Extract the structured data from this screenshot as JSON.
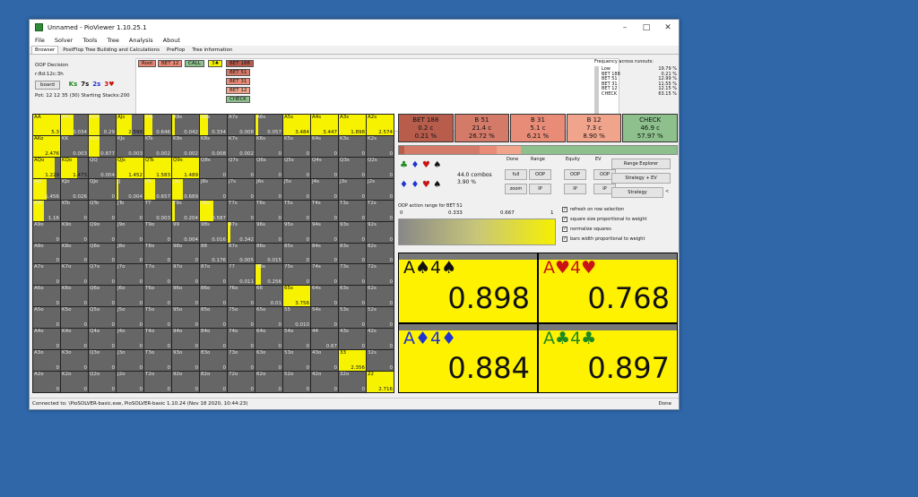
{
  "window": {
    "title": "Unnamed - PioViewer 1.10.25.1",
    "menus": [
      "File",
      "Solver",
      "Tools",
      "Tree",
      "Analysis",
      "About"
    ],
    "tabs": [
      "Browser",
      "PostFlop Tree Building and Calculations",
      "PreFlop",
      "Tree information"
    ]
  },
  "info": {
    "player": "OOP Decision",
    "board_cards": "r:8d:12c:3h",
    "board_button": "board",
    "cards": [
      {
        "t": "Ks",
        "c": "#1e8a1e"
      },
      {
        "t": "7s",
        "c": "#111"
      },
      {
        "t": "2s",
        "c": "#1e33d1"
      },
      {
        "t": "3♥",
        "c": "#c81414"
      }
    ],
    "pot_line": "Pot: 12 12 35 (30) Starting Stacks:200"
  },
  "tree": {
    "nodes": [
      {
        "label": "Root",
        "bg": "#e88874"
      },
      {
        "label": "BET 12",
        "bg": "#e88874"
      },
      {
        "label": "CALL",
        "bg": "#8dc08d"
      },
      {
        "label": "3♠",
        "bg": "#f6f200"
      },
      {
        "label": "BET 188",
        "bg": "#b85c4c"
      },
      {
        "label": "BET 51",
        "bg": "#d47a68"
      },
      {
        "label": "BET 31",
        "bg": "#e88c78"
      },
      {
        "label": "BET 12",
        "bg": "#f0a48c"
      },
      {
        "label": "CHECK",
        "bg": "#8dc08d"
      }
    ]
  },
  "frequency": {
    "header": "Frequency across runouts:",
    "rows": [
      {
        "name": "Low",
        "value": "19.79 %"
      },
      {
        "name": "",
        "value": ""
      },
      {
        "name": "BET 188",
        "value": "0.21 %"
      },
      {
        "name": "BET 51",
        "value": "12.99 %"
      },
      {
        "name": "BET 31",
        "value": "11.55 %"
      },
      {
        "name": "BET 12",
        "value": "12.15 %"
      },
      {
        "name": "CHECK",
        "value": "63.15 %"
      }
    ]
  },
  "matrix": {
    "cells": [
      [
        "AA",
        "5.3",
        1
      ],
      [
        "AKs",
        "0.034",
        0.45
      ],
      [
        "AQs",
        "0.29",
        0.4
      ],
      [
        "AJs",
        "2.599",
        0.55
      ],
      [
        "ATs",
        "0.646",
        0.3
      ],
      [
        "A9s",
        "0.042",
        0.1
      ],
      [
        "A8s",
        "0.334",
        0.3
      ],
      [
        "A7s",
        "0.008",
        0
      ],
      [
        "A6s",
        "0.057",
        0.1
      ],
      [
        "A5s",
        "3.484",
        1
      ],
      [
        "A4s",
        "3.447",
        1
      ],
      [
        "A3s",
        "1.898",
        1
      ],
      [
        "A2s",
        "2.574",
        1
      ],
      [
        "AKo",
        "2.476",
        1
      ],
      [
        "KK",
        "0.003",
        0
      ],
      [
        "KQs",
        "0.877",
        0.4
      ],
      [
        "KJs",
        "0.003",
        0
      ],
      [
        "KTs",
        "0.002",
        0
      ],
      [
        "K9s",
        "0.002",
        0
      ],
      [
        "K8s",
        "0.008",
        0
      ],
      [
        "K7s",
        "0.002",
        0
      ],
      [
        "K6s",
        "0",
        0
      ],
      [
        "K5s",
        "0",
        0
      ],
      [
        "K4s",
        "0",
        0
      ],
      [
        "K3s",
        "0",
        0
      ],
      [
        "K2s",
        "0",
        0
      ],
      [
        "AQo",
        "1.229",
        0.8
      ],
      [
        "KQo",
        "1.473",
        0.6
      ],
      [
        "QQ",
        "0.004",
        0
      ],
      [
        "QJs",
        "1.452",
        1
      ],
      [
        "QTs",
        "1.583",
        1
      ],
      [
        "Q9s",
        "1.489",
        1
      ],
      [
        "Q8s",
        "0",
        0
      ],
      [
        "Q7s",
        "0",
        0
      ],
      [
        "Q6s",
        "0",
        0
      ],
      [
        "Q5s",
        "0",
        0
      ],
      [
        "Q4s",
        "0",
        0
      ],
      [
        "Q3s",
        "0",
        0
      ],
      [
        "Q2s",
        "0",
        0
      ],
      [
        "AJo",
        "1.456",
        0.5
      ],
      [
        "KJo",
        "0.026",
        0
      ],
      [
        "QJo",
        "0",
        0
      ],
      [
        "JJ",
        "0.004",
        0.05
      ],
      [
        "JTs",
        "0.657",
        0.4
      ],
      [
        "J9s",
        "0.689",
        0.4
      ],
      [
        "J8s",
        "0",
        0
      ],
      [
        "J7s",
        "0",
        0
      ],
      [
        "J6s",
        "0",
        0
      ],
      [
        "J5s",
        "0",
        0
      ],
      [
        "J4s",
        "0",
        0
      ],
      [
        "J3s",
        "0",
        0
      ],
      [
        "J2s",
        "0",
        0
      ],
      [
        "ATo",
        "1.16",
        0.4
      ],
      [
        "KTo",
        "0",
        0
      ],
      [
        "QTo",
        "0",
        0
      ],
      [
        "JTo",
        "0",
        0
      ],
      [
        "TT",
        "0.003",
        0
      ],
      [
        "T9s",
        "0.204",
        0.1
      ],
      [
        "T8s",
        "0.587",
        0.5
      ],
      [
        "T7s",
        "0",
        0
      ],
      [
        "T6s",
        "0",
        0
      ],
      [
        "T5s",
        "0",
        0
      ],
      [
        "T4s",
        "0",
        0
      ],
      [
        "T3s",
        "0",
        0
      ],
      [
        "T2s",
        "0",
        0
      ],
      [
        "A9o",
        "0",
        0
      ],
      [
        "K9o",
        "0",
        0
      ],
      [
        "Q9o",
        "0",
        0
      ],
      [
        "J9o",
        "0",
        0
      ],
      [
        "T9o",
        "0",
        0
      ],
      [
        "99",
        "0.004",
        0
      ],
      [
        "98s",
        "0.016",
        0
      ],
      [
        "97s",
        "0.342",
        0.1
      ],
      [
        "96s",
        "0",
        0
      ],
      [
        "95s",
        "0",
        0
      ],
      [
        "94s",
        "0",
        0
      ],
      [
        "93s",
        "0",
        0
      ],
      [
        "92s",
        "0",
        0
      ],
      [
        "A8o",
        "0",
        0
      ],
      [
        "K8o",
        "0",
        0
      ],
      [
        "Q8o",
        "0",
        0
      ],
      [
        "J8o",
        "0",
        0
      ],
      [
        "T8o",
        "0",
        0
      ],
      [
        "98o",
        "0",
        0
      ],
      [
        "88",
        "0.176",
        0
      ],
      [
        "87s",
        "0.005",
        0
      ],
      [
        "86s",
        "0.015",
        0
      ],
      [
        "85s",
        "0",
        0
      ],
      [
        "84s",
        "0",
        0
      ],
      [
        "83s",
        "0",
        0
      ],
      [
        "82s",
        "0",
        0
      ],
      [
        "A7o",
        "0",
        0
      ],
      [
        "K7o",
        "0",
        0
      ],
      [
        "Q7o",
        "0",
        0
      ],
      [
        "J7o",
        "0",
        0
      ],
      [
        "T7o",
        "0",
        0
      ],
      [
        "97o",
        "0",
        0
      ],
      [
        "87o",
        "0",
        0
      ],
      [
        "77",
        "0.011",
        0
      ],
      [
        "76s",
        "0.256",
        0.2
      ],
      [
        "75s",
        "0",
        0
      ],
      [
        "74s",
        "0",
        0
      ],
      [
        "73s",
        "0",
        0
      ],
      [
        "72s",
        "0",
        0
      ],
      [
        "A6o",
        "0",
        0
      ],
      [
        "K6o",
        "0",
        0
      ],
      [
        "Q6o",
        "0",
        0
      ],
      [
        "J6o",
        "0",
        0
      ],
      [
        "T6o",
        "0",
        0
      ],
      [
        "96o",
        "0",
        0
      ],
      [
        "86o",
        "0",
        0
      ],
      [
        "76o",
        "0",
        0
      ],
      [
        "66",
        "0.01",
        0
      ],
      [
        "65s",
        "3.756",
        1
      ],
      [
        "64s",
        "0",
        0
      ],
      [
        "63s",
        "0",
        0
      ],
      [
        "62s",
        "0",
        0
      ],
      [
        "A5o",
        "0",
        0
      ],
      [
        "K5o",
        "0",
        0
      ],
      [
        "Q5o",
        "0",
        0
      ],
      [
        "J5o",
        "0",
        0
      ],
      [
        "T5o",
        "0",
        0
      ],
      [
        "95o",
        "0",
        0
      ],
      [
        "85o",
        "0",
        0
      ],
      [
        "75o",
        "0",
        0
      ],
      [
        "65o",
        "0",
        0
      ],
      [
        "55",
        "0.010",
        0
      ],
      [
        "54s",
        "0",
        0
      ],
      [
        "53s",
        "0",
        0
      ],
      [
        "52s",
        "0",
        0
      ],
      [
        "A4o",
        "0",
        0
      ],
      [
        "K4o",
        "0",
        0
      ],
      [
        "Q4o",
        "0",
        0
      ],
      [
        "J4o",
        "0",
        0
      ],
      [
        "T4o",
        "0",
        0
      ],
      [
        "94o",
        "0",
        0
      ],
      [
        "84o",
        "0",
        0
      ],
      [
        "74o",
        "0",
        0
      ],
      [
        "64o",
        "0",
        0
      ],
      [
        "54o",
        "0",
        0
      ],
      [
        "44",
        "0.67",
        0
      ],
      [
        "43s",
        "0",
        0
      ],
      [
        "42s",
        "0",
        0
      ],
      [
        "A3o",
        "0",
        0
      ],
      [
        "K3o",
        "0",
        0
      ],
      [
        "Q3o",
        "0",
        0
      ],
      [
        "J3o",
        "0",
        0
      ],
      [
        "T3o",
        "0",
        0
      ],
      [
        "93o",
        "0",
        0
      ],
      [
        "83o",
        "0",
        0
      ],
      [
        "73o",
        "0",
        0
      ],
      [
        "63o",
        "0",
        0
      ],
      [
        "53o",
        "0",
        0
      ],
      [
        "43o",
        "0",
        0
      ],
      [
        "33",
        "2.356",
        1
      ],
      [
        "32s",
        "0",
        0
      ],
      [
        "A2o",
        "0",
        0
      ],
      [
        "K2o",
        "0",
        0
      ],
      [
        "Q2o",
        "0",
        0
      ],
      [
        "J2o",
        "0",
        0
      ],
      [
        "T2o",
        "0",
        0
      ],
      [
        "92o",
        "0",
        0
      ],
      [
        "82o",
        "0",
        0
      ],
      [
        "72o",
        "0",
        0
      ],
      [
        "62o",
        "0",
        0
      ],
      [
        "52o",
        "0",
        0
      ],
      [
        "42o",
        "0",
        0
      ],
      [
        "32o",
        "0",
        0
      ],
      [
        "22",
        "2.716",
        1
      ]
    ]
  },
  "actions": [
    {
      "name": "BET 188",
      "amt": "0.2 c",
      "pct": "0.21 %",
      "bg": "#b85c4c"
    },
    {
      "name": "B 51",
      "amt": "21.4 c",
      "pct": "26.72 %",
      "bg": "#d47a68"
    },
    {
      "name": "B 31",
      "amt": "5.1 c",
      "pct": "6.21 %",
      "bg": "#e88c78"
    },
    {
      "name": "B 12",
      "amt": "7.3 c",
      "pct": "8.90 %",
      "bg": "#f0a48c"
    },
    {
      "name": "CHECK",
      "amt": "46.9 c",
      "pct": "57.97 %",
      "bg": "#8dc08d"
    }
  ],
  "strip": [
    0.02,
    0.27,
    0.06,
    0.09,
    0.56
  ],
  "controls": {
    "combos": "44.0 combos",
    "combos_pct": "3.90 %",
    "col_labels": [
      "Done",
      "Range",
      "Equity",
      "EV"
    ],
    "buttons": [
      "full",
      "OOP",
      "OOP",
      "OOP",
      "zoom",
      "IP",
      "IP",
      "IP"
    ],
    "side_buttons": [
      "Range Explorer",
      "Strategy + EV",
      "Strategy"
    ],
    "side_extra": "<",
    "range_label": "OOP action range for BET 51",
    "grad_ticks": [
      "0",
      "0.333",
      "0.667",
      "1"
    ],
    "checks": [
      "refresh on row selection",
      "square size proportional to weight",
      "normalize squares",
      "bars width proportional to weight"
    ]
  },
  "equity": [
    {
      "r1": "A",
      "s1": "♠",
      "r2": "4",
      "s2": "♠",
      "color": "#111",
      "value": "0.898"
    },
    {
      "r1": "A",
      "s1": "♥",
      "r2": "4",
      "s2": "♥",
      "color": "#c81414",
      "value": "0.768"
    },
    {
      "r1": "A",
      "s1": "♦",
      "r2": "4",
      "s2": "♦",
      "color": "#1e33d1",
      "value": "0.884"
    },
    {
      "r1": "A",
      "s1": "♣",
      "r2": "4",
      "s2": "♣",
      "color": "#1e8a1e",
      "value": "0.897"
    }
  ],
  "status": {
    "left": "Connected to: \\PioSOLVER-basic.exe, PioSOLVER-basic 1.10.24 (Nov 18 2020, 10:44:23)",
    "right": "Done"
  }
}
